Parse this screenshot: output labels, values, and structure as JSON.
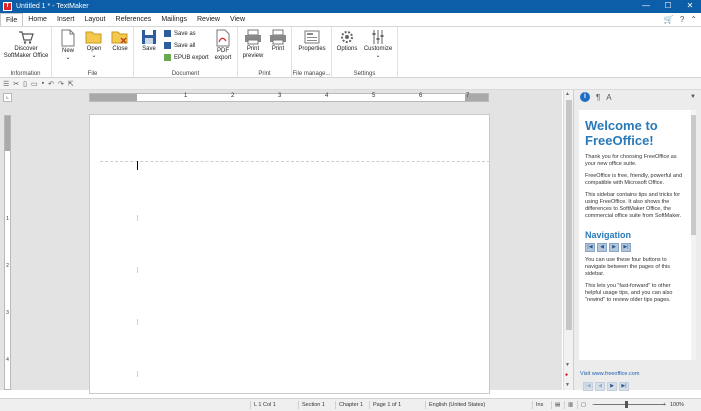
{
  "window": {
    "title": "Untitled 1 * - TextMaker",
    "app_icon_letter": "T",
    "minimize": "—",
    "maximize": "☐",
    "close": "✕"
  },
  "menu": {
    "tabs": [
      "File",
      "Home",
      "Insert",
      "Layout",
      "References",
      "Mailings",
      "Review",
      "View"
    ],
    "active_index": 0
  },
  "ribbon": {
    "groups": {
      "information": "Information",
      "file": "File",
      "document": "Document",
      "print": "Print",
      "file_manager": "File manage...",
      "settings": "Settings"
    },
    "buttons": {
      "discover": "Discover SoftMaker Office",
      "new": "New",
      "open": "Open",
      "close": "Close",
      "save": "Save",
      "save_as": "Save as",
      "save_all": "Save all",
      "epub_export": "EPUB export",
      "pdf_export": "PDF export",
      "print_preview": "Print preview",
      "print": "Print",
      "properties": "Properties",
      "options": "Options",
      "customize": "Customize"
    }
  },
  "ruler": {
    "h_numbers": [
      "1",
      "2",
      "3",
      "4",
      "5",
      "6",
      "7"
    ],
    "v_numbers": [
      "1",
      "2",
      "3",
      "4"
    ]
  },
  "sidebar": {
    "welcome_title": "Welcome to FreeOffice!",
    "p1": "Thank you for choosing FreeOffice as your new office suite.",
    "p2": "FreeOffice is free, friendly, powerful and compatible with Microsoft Office.",
    "p3": "This sidebar contains tips and tricks for using FreeOffice. It also shows the differences to SoftMaker Office, the commercial office suite from SoftMaker.",
    "nav_title": "Navigation",
    "p4": "You can use these four buttons to navigate between the pages of this sidebar.",
    "p5": "This lets you \"fast-forward\" to other helpful usage tips, and you can also \"rewind\" to review older tips pages.",
    "link": "Visit www.freeoffice.com"
  },
  "status": {
    "position": "L 1 Col 1",
    "section": "Section 1",
    "chapter": "Chapter 1",
    "page": "Page 1 of 1",
    "language": "English (United States)",
    "mode": "Ins",
    "zoom": "100%"
  }
}
